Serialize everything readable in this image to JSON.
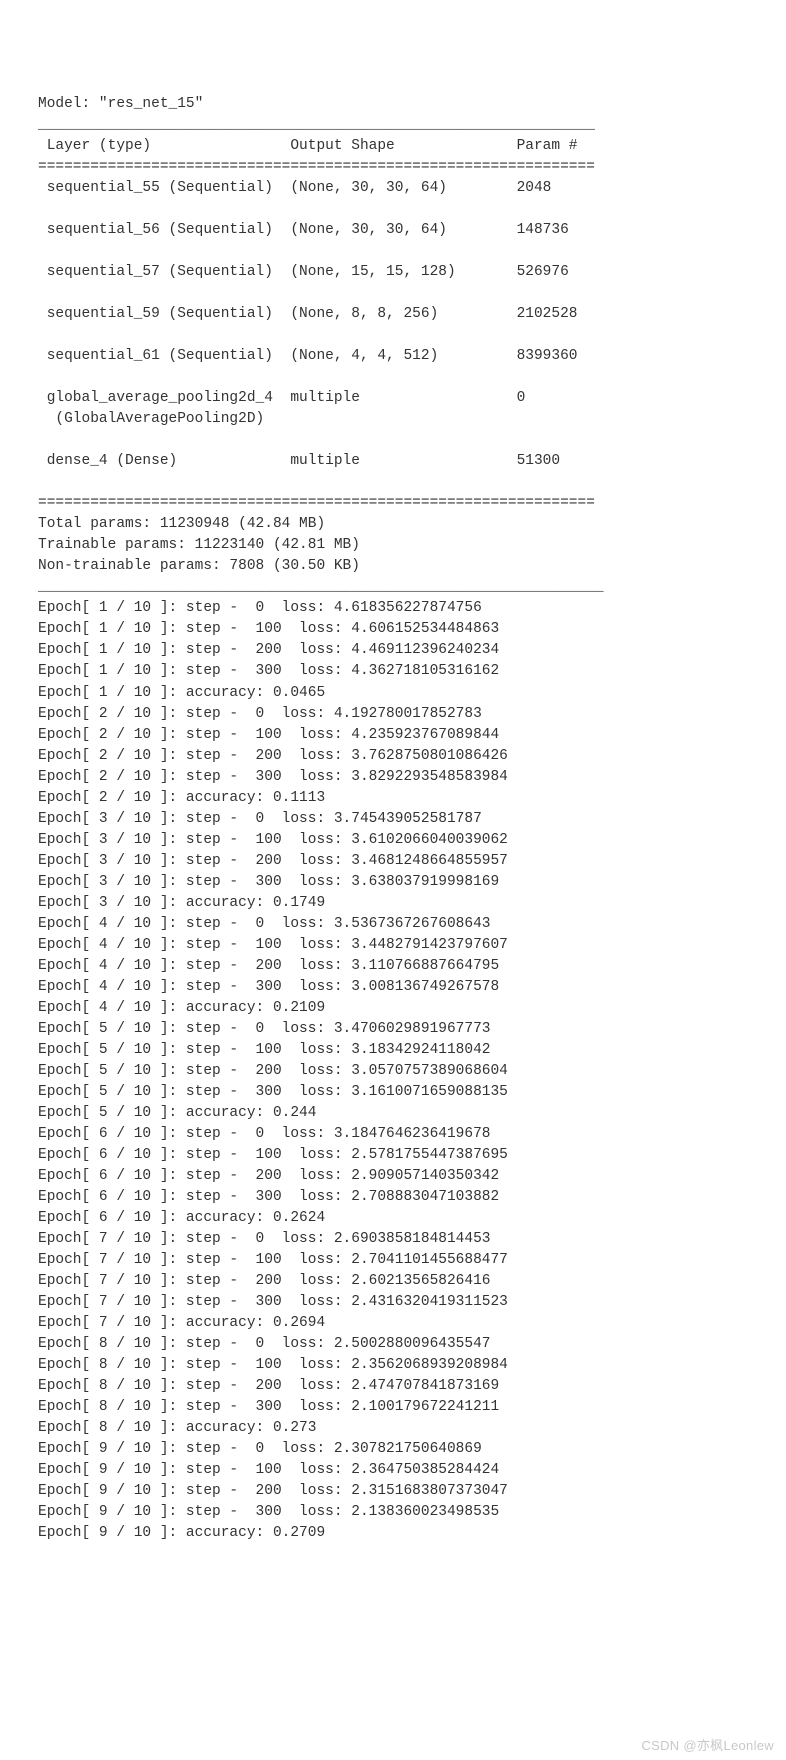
{
  "model_name": "\"res_net_15\"",
  "header_cols": [
    "Layer (type)",
    "Output Shape",
    "Param #"
  ],
  "double_rule": "================================================================",
  "single_rule": "________________________________________________________________",
  "thin_rule": "_________________________________________________________________",
  "layers": [
    {
      "name": "sequential_55 (Sequential)",
      "shape": "(None, 30, 30, 64)",
      "params": "2048"
    },
    {
      "name": "sequential_56 (Sequential)",
      "shape": "(None, 30, 30, 64)",
      "params": "148736"
    },
    {
      "name": "sequential_57 (Sequential)",
      "shape": "(None, 15, 15, 128)",
      "params": "526976"
    },
    {
      "name": "sequential_59 (Sequential)",
      "shape": "(None, 8, 8, 256)",
      "params": "2102528"
    },
    {
      "name": "sequential_61 (Sequential)",
      "shape": "(None, 4, 4, 512)",
      "params": "8399360"
    },
    {
      "name": "global_average_pooling2d_4",
      "sub": " (GlobalAveragePooling2D)",
      "shape": "multiple",
      "params": "0"
    },
    {
      "name": "dense_4 (Dense)",
      "shape": "multiple",
      "params": "51300"
    }
  ],
  "totals": [
    "Total params: 11230948 (42.84 MB)",
    "Trainable params: 11223140 (42.81 MB)",
    "Non-trainable params: 7808 (30.50 KB)"
  ],
  "log": [
    "Epoch[ 1 / 10 ]: step -  0  loss: 4.618356227874756",
    "Epoch[ 1 / 10 ]: step -  100  loss: 4.606152534484863",
    "Epoch[ 1 / 10 ]: step -  200  loss: 4.469112396240234",
    "Epoch[ 1 / 10 ]: step -  300  loss: 4.362718105316162",
    "Epoch[ 1 / 10 ]: accuracy: 0.0465",
    "Epoch[ 2 / 10 ]: step -  0  loss: 4.192780017852783",
    "Epoch[ 2 / 10 ]: step -  100  loss: 4.235923767089844",
    "Epoch[ 2 / 10 ]: step -  200  loss: 3.7628750801086426",
    "Epoch[ 2 / 10 ]: step -  300  loss: 3.8292293548583984",
    "Epoch[ 2 / 10 ]: accuracy: 0.1113",
    "Epoch[ 3 / 10 ]: step -  0  loss: 3.745439052581787",
    "Epoch[ 3 / 10 ]: step -  100  loss: 3.6102066040039062",
    "Epoch[ 3 / 10 ]: step -  200  loss: 3.4681248664855957",
    "Epoch[ 3 / 10 ]: step -  300  loss: 3.638037919998169",
    "Epoch[ 3 / 10 ]: accuracy: 0.1749",
    "Epoch[ 4 / 10 ]: step -  0  loss: 3.5367367267608643",
    "Epoch[ 4 / 10 ]: step -  100  loss: 3.4482791423797607",
    "Epoch[ 4 / 10 ]: step -  200  loss: 3.110766887664795",
    "Epoch[ 4 / 10 ]: step -  300  loss: 3.008136749267578",
    "Epoch[ 4 / 10 ]: accuracy: 0.2109",
    "Epoch[ 5 / 10 ]: step -  0  loss: 3.4706029891967773",
    "Epoch[ 5 / 10 ]: step -  100  loss: 3.18342924118042",
    "Epoch[ 5 / 10 ]: step -  200  loss: 3.0570757389068604",
    "Epoch[ 5 / 10 ]: step -  300  loss: 3.1610071659088135",
    "Epoch[ 5 / 10 ]: accuracy: 0.244",
    "Epoch[ 6 / 10 ]: step -  0  loss: 3.1847646236419678",
    "Epoch[ 6 / 10 ]: step -  100  loss: 2.5781755447387695",
    "Epoch[ 6 / 10 ]: step -  200  loss: 2.909057140350342",
    "Epoch[ 6 / 10 ]: step -  300  loss: 2.708883047103882",
    "Epoch[ 6 / 10 ]: accuracy: 0.2624",
    "Epoch[ 7 / 10 ]: step -  0  loss: 2.6903858184814453",
    "Epoch[ 7 / 10 ]: step -  100  loss: 2.7041101455688477",
    "Epoch[ 7 / 10 ]: step -  200  loss: 2.60213565826416",
    "Epoch[ 7 / 10 ]: step -  300  loss: 2.4316320419311523",
    "Epoch[ 7 / 10 ]: accuracy: 0.2694",
    "Epoch[ 8 / 10 ]: step -  0  loss: 2.5002880096435547",
    "Epoch[ 8 / 10 ]: step -  100  loss: 2.3562068939208984",
    "Epoch[ 8 / 10 ]: step -  200  loss: 2.474707841873169",
    "Epoch[ 8 / 10 ]: step -  300  loss: 2.100179672241211",
    "Epoch[ 8 / 10 ]: accuracy: 0.273",
    "Epoch[ 9 / 10 ]: step -  0  loss: 2.307821750640869",
    "Epoch[ 9 / 10 ]: step -  100  loss: 2.364750385284424",
    "Epoch[ 9 / 10 ]: step -  200  loss: 2.3151683807373047",
    "Epoch[ 9 / 10 ]: step -  300  loss: 2.138360023498535",
    "Epoch[ 9 / 10 ]: accuracy: 0.2709"
  ],
  "watermark": "CSDN @亦枫Leonlew"
}
